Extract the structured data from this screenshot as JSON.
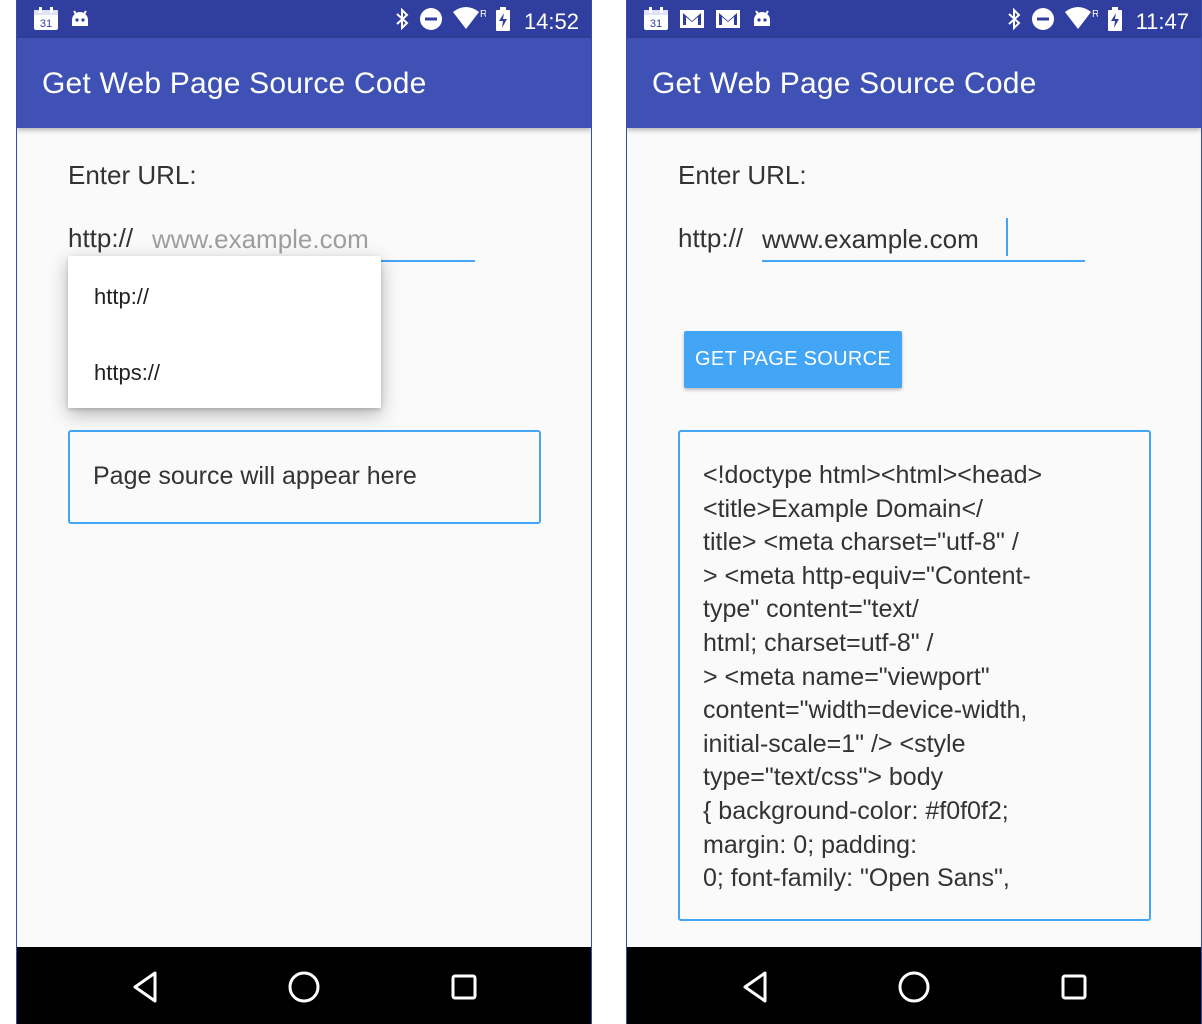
{
  "phones": [
    {
      "status": {
        "time": "14:52",
        "calendar_day": "31",
        "roaming": "R"
      },
      "app_title": "Get Web Page Source Code",
      "enter_url_label": "Enter URL:",
      "url_prefix": "http://",
      "url_input": {
        "value": "",
        "placeholder": "www.example.com"
      },
      "dropdown_options": [
        "http://",
        "https://"
      ],
      "source_box_text": "Page source will appear here"
    },
    {
      "status": {
        "time": "11:47",
        "calendar_day": "31",
        "roaming": "R"
      },
      "app_title": "Get Web Page Source Code",
      "enter_url_label": "Enter URL:",
      "url_prefix": "http://",
      "url_input": {
        "value": "www.example.com",
        "placeholder": ""
      },
      "get_button_label": "GET PAGE SOURCE",
      "source_box_text": "<!doctype html><html><head>\n<title>Example Domain</\ntitle>    <meta charset=\"utf-8\" /\n>    <meta http-equiv=\"Content-\ntype\" content=\"text/\nhtml; charset=utf-8\" /\n>    <meta name=\"viewport\"\ncontent=\"width=device-width,\ninitial-scale=1\" />    <style\ntype=\"text/css\">    body\n{        background-color: #f0f0f2;\nmargin: 0;        padding:\n0;        font-family: \"Open Sans\","
    }
  ],
  "icons": {
    "status_left_1": [
      "calendar-icon",
      "android-icon"
    ],
    "status_left_2": [
      "calendar-icon",
      "gmail-icon",
      "gmail-icon",
      "android-icon"
    ],
    "status_right": [
      "bluetooth-icon",
      "do-not-disturb-icon",
      "wifi-icon",
      "battery-charging-icon"
    ],
    "nav": [
      "back-icon",
      "home-icon",
      "recents-icon"
    ]
  },
  "colors": {
    "status_bar": "#303f9f",
    "app_bar": "#3f51b5",
    "accent": "#42a5f5",
    "background": "#fafafa",
    "nav_bar": "#000000"
  }
}
